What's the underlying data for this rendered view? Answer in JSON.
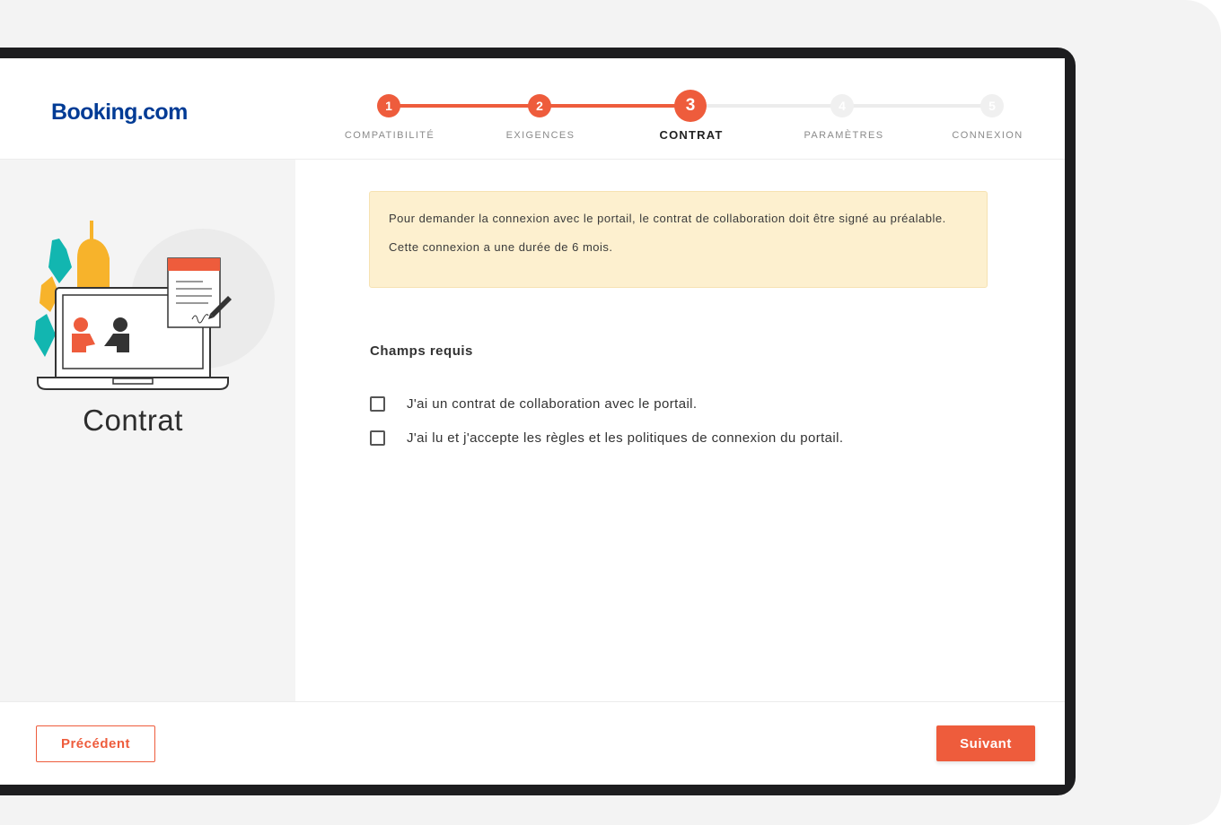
{
  "brand": {
    "logo_text": "Booking.com",
    "logo_color": "#003b95"
  },
  "stepper": {
    "accent": "#ee5c3c",
    "current_step": 3,
    "steps": [
      {
        "number": "1",
        "label": "COMPATIBILITÉ",
        "state": "done"
      },
      {
        "number": "2",
        "label": "EXIGENCES",
        "state": "done"
      },
      {
        "number": "3",
        "label": "CONTRAT",
        "state": "current"
      },
      {
        "number": "4",
        "label": "PARAMÈTRES",
        "state": "todo"
      },
      {
        "number": "5",
        "label": "CONNEXION",
        "state": "todo"
      }
    ]
  },
  "sidebar": {
    "title": "Contrat",
    "illustration": "contract-signing-illustration"
  },
  "notice": {
    "line1": "Pour demander la connexion avec le portail, le contrat de collaboration doit être signé au préalable.",
    "line2": "Cette connexion a une durée de 6 mois.",
    "background": "#fdf0cf"
  },
  "form": {
    "section_title": "Champs requis",
    "checkboxes": [
      {
        "label": "J'ai un contrat de collaboration avec le portail.",
        "checked": false
      },
      {
        "label": "J'ai lu et j'accepte les règles et les politiques de connexion du portail.",
        "checked": false
      }
    ]
  },
  "footer": {
    "prev_label": "Précédent",
    "next_label": "Suivant"
  }
}
